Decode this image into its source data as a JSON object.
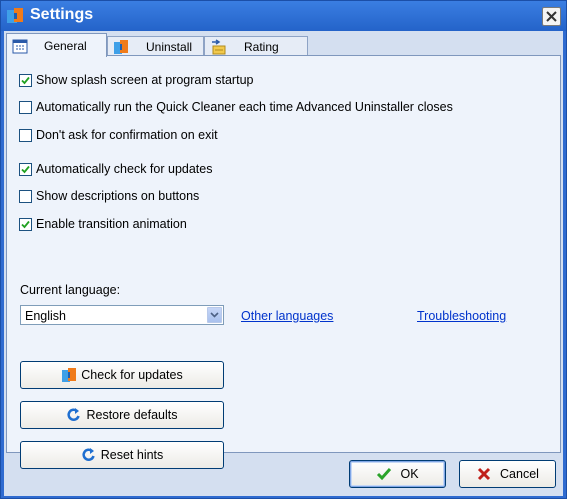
{
  "window": {
    "title": "Settings",
    "accent_color": "#2f6bd0",
    "icons": {
      "app": "app-logo-icon",
      "close": "close-x-icon"
    }
  },
  "tabs": [
    {
      "label": "General",
      "icon": "calendar-icon",
      "active": true
    },
    {
      "label": "Uninstall",
      "icon": "uninstall-icon",
      "active": false
    },
    {
      "label": "Rating",
      "icon": "rating-icon",
      "active": false
    }
  ],
  "options": [
    {
      "label": "Show splash screen at program startup",
      "checked": true
    },
    {
      "label": "Automatically run the Quick Cleaner each time Advanced Uninstaller closes",
      "checked": false
    },
    {
      "label": "Don't ask for confirmation on exit",
      "checked": false
    },
    {
      "label": "Automatically check for updates",
      "checked": true
    },
    {
      "label": "Show descriptions on buttons",
      "checked": false
    },
    {
      "label": "Enable transition animation",
      "checked": true
    }
  ],
  "language": {
    "label": "Current language:",
    "selected": "English",
    "other_languages_link": "Other languages",
    "troubleshooting_link": "Troubleshooting"
  },
  "buttons": {
    "check_updates": "Check for updates",
    "restore_defaults": "Restore defaults",
    "reset_hints": "Reset hints"
  },
  "footer": {
    "ok": "OK",
    "cancel": "Cancel"
  }
}
